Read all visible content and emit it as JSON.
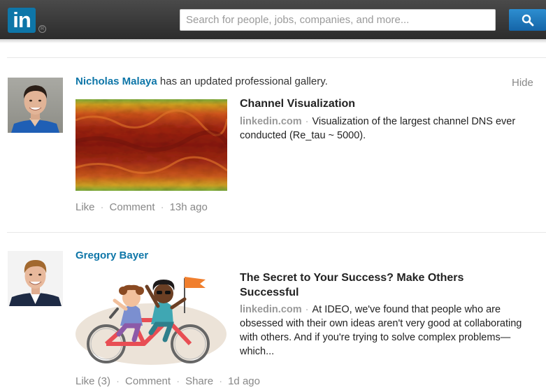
{
  "header": {
    "logo_text": "in",
    "logo_mark": "R",
    "search_placeholder": "Search for people, jobs, companies, and more...",
    "search_icon": "search-icon",
    "brand_color": "#0e76a8"
  },
  "feed": {
    "items": [
      {
        "author": "Nicholas Malaya",
        "activity": " has an updated professional gallery.",
        "hide_label": "Hide",
        "title": "Channel Visualization",
        "source": "linkedin.com",
        "separator": "·",
        "body": "Visualization of the largest channel DNS ever conducted (Re_tau ~ 5000).",
        "actions": [
          {
            "label": "Like"
          },
          {
            "label": "Comment"
          }
        ],
        "timestamp": "13h ago"
      },
      {
        "author": "Gregory Bayer",
        "title": "The Secret to Your Success? Make Others Successful",
        "source": "linkedin.com",
        "separator": "·",
        "body": "At IDEO, we've found that people who are obsessed with their own ideas aren't very good at collaborating with others. And if you're trying to solve complex problems—which...",
        "actions": [
          {
            "label": "Like (3)"
          },
          {
            "label": "Comment"
          },
          {
            "label": "Share"
          }
        ],
        "timestamp": "1d ago"
      }
    ]
  }
}
